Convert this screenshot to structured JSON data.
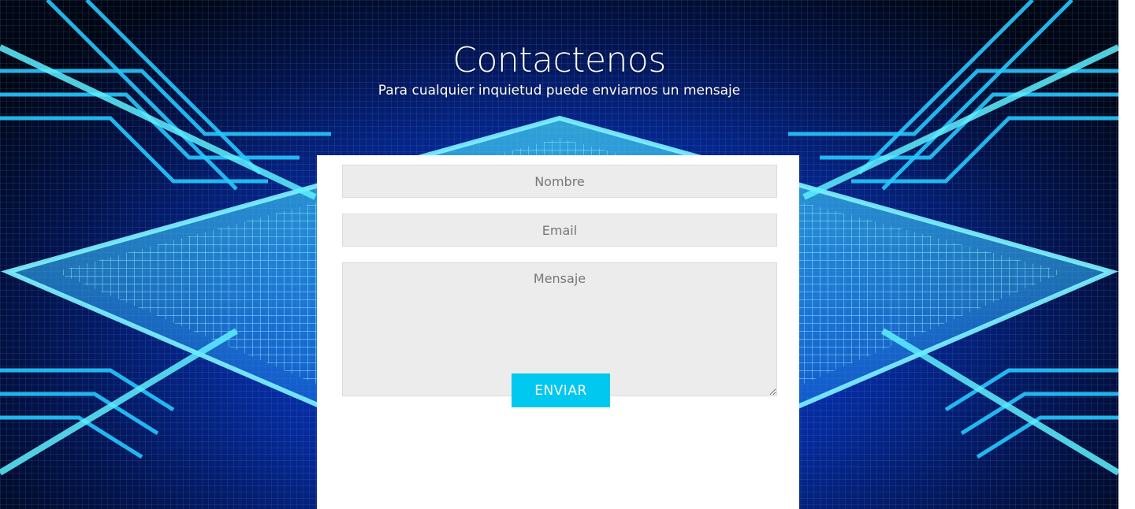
{
  "contact": {
    "title": "Contactenos",
    "subtitle": "Para cualquier inquietud puede enviarnos un mensaje"
  },
  "form": {
    "name_placeholder": "Nombre",
    "email_placeholder": "Email",
    "message_placeholder": "Mensaje",
    "submit_label": "ENVIAR"
  },
  "colors": {
    "accent": "#00c8ef",
    "field_background": "#edecec",
    "hero_blue": "#0a3fd8",
    "glow_cyan": "#3cdcff"
  }
}
